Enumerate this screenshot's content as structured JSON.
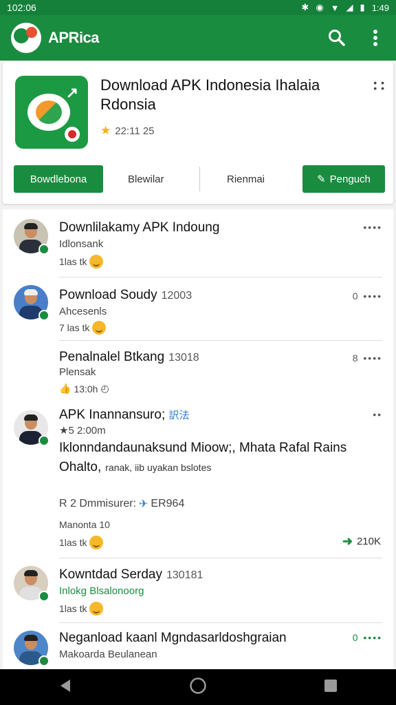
{
  "status": {
    "time": "102:06",
    "clock": "1:49"
  },
  "appbar": {
    "title": "APRica"
  },
  "app_card": {
    "title": "Download APK Indonesia Ihalaia Rdonsia",
    "rating": "22:11 25",
    "primary_button": "Bowdlebona",
    "button_2": "Blewilar",
    "button_3": "Rienmai",
    "secondary_button": "Penguch"
  },
  "posts": [
    {
      "title": "Downlilakamy APK Indoung",
      "sub": "Idlonsank",
      "meta": "1las tk"
    },
    {
      "title": "Pownload Soudy",
      "time": "12003",
      "sub": "Ahcesenls",
      "meta": "7 las tk",
      "more": "0 ••••"
    },
    {
      "title": "Penalnalel Btkang",
      "time": "13018",
      "sub": "Plensak",
      "meta": "13:0h",
      "more": "8 ••••"
    },
    {
      "title": "APK Inannansuro;",
      "badge": "訳法",
      "rating": "★5 2:00m",
      "line1": "Iklonndandaunaksund Mioow;, Mhata Rafal Rains",
      "line2": "Ohalto,",
      "line2_small": "ranak, iib uyakan bslotes",
      "reaction": "R 2 Dmmisurer:",
      "reaction_tag": "ER964",
      "sub": "Manonta 10",
      "meta": "1las tk",
      "share": "210K"
    },
    {
      "title": "Kowntdad Serday",
      "time": "130181",
      "sub": "Inlokg Blsalonoorg",
      "meta": "1las tk"
    },
    {
      "title": "Neganload kaanl Mgndasarldoshgraian",
      "sub": "Makoarda Beulanean",
      "more": "0 ••••"
    }
  ]
}
